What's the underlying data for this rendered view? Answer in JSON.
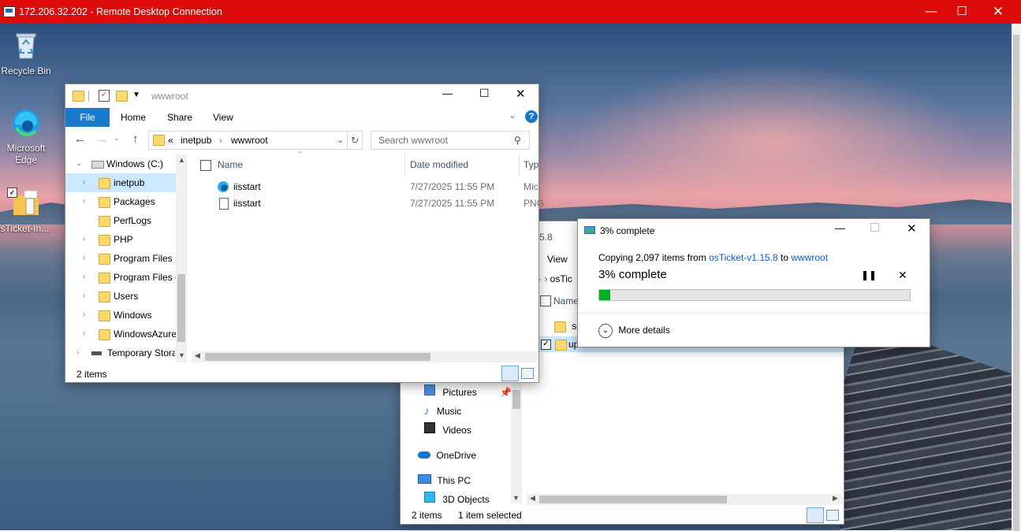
{
  "rdp": {
    "title": "172.206.32.202 - Remote Desktop Connection"
  },
  "desktop": {
    "icons": [
      {
        "label": "Recycle Bin"
      },
      {
        "label": "Microsoft Edge"
      },
      {
        "label": "osTicket-In..."
      }
    ]
  },
  "explorer_front": {
    "title": "wwwroot",
    "ribbon_tabs": [
      "File",
      "Home",
      "Share",
      "View"
    ],
    "address": {
      "prefix": "«",
      "crumbs": [
        "inetpub",
        "wwwroot"
      ]
    },
    "search_placeholder": "Search wwwroot",
    "nav_tree": [
      {
        "label": "Windows (C:)",
        "level": 0,
        "expanded": true
      },
      {
        "label": "inetpub",
        "level": 1,
        "selected": true
      },
      {
        "label": "Packages",
        "level": 1
      },
      {
        "label": "PerfLogs",
        "level": 1
      },
      {
        "label": "PHP",
        "level": 1
      },
      {
        "label": "Program Files",
        "level": 1
      },
      {
        "label": "Program Files (",
        "level": 1
      },
      {
        "label": "Users",
        "level": 1
      },
      {
        "label": "Windows",
        "level": 1
      },
      {
        "label": "WindowsAzure",
        "level": 1
      },
      {
        "label": "Temporary Stora",
        "level": 0
      }
    ],
    "columns": {
      "name": "Name",
      "date": "Date modified",
      "type": "Typ"
    },
    "files": [
      {
        "name": "iisstart",
        "date": "7/27/2025 11:55 PM",
        "type": "Mic",
        "icon": "edge-icon"
      },
      {
        "name": "iisstart",
        "date": "7/27/2025 11:55 PM",
        "type": "PNG",
        "icon": "image-file-icon"
      }
    ],
    "status": "2 items"
  },
  "explorer_back": {
    "title_fragment": "5.8",
    "view_tab": "View",
    "address_fragment": "osTic",
    "column_name": "Name",
    "rows": [
      {
        "name": "sc"
      },
      {
        "name": "upload"
      }
    ],
    "nav_items": [
      {
        "label": "Pictures",
        "icon": "pictures-icon"
      },
      {
        "label": "Music",
        "icon": "music-icon"
      },
      {
        "label": "Videos",
        "icon": "videos-icon"
      },
      {
        "label": "OneDrive",
        "icon": "onedrive-icon"
      },
      {
        "label": "This PC",
        "icon": "computer-icon"
      },
      {
        "label": "3D Objects",
        "icon": "3d-objects-icon"
      }
    ],
    "status_items": "2 items",
    "status_selected": "1 item selected"
  },
  "copy_dialog": {
    "title": "3% complete",
    "line_prefix": "Copying 2,097 items from",
    "source": "osTicket-v1.15.8",
    "to_word": "to",
    "dest": "wwwroot",
    "percent_label": "3% complete",
    "progress": 0.03,
    "more_details": "More details"
  },
  "colors": {
    "rdp_bar": "#dd0a0a",
    "accent": "#0b5ed7",
    "progress": "#06b025"
  }
}
